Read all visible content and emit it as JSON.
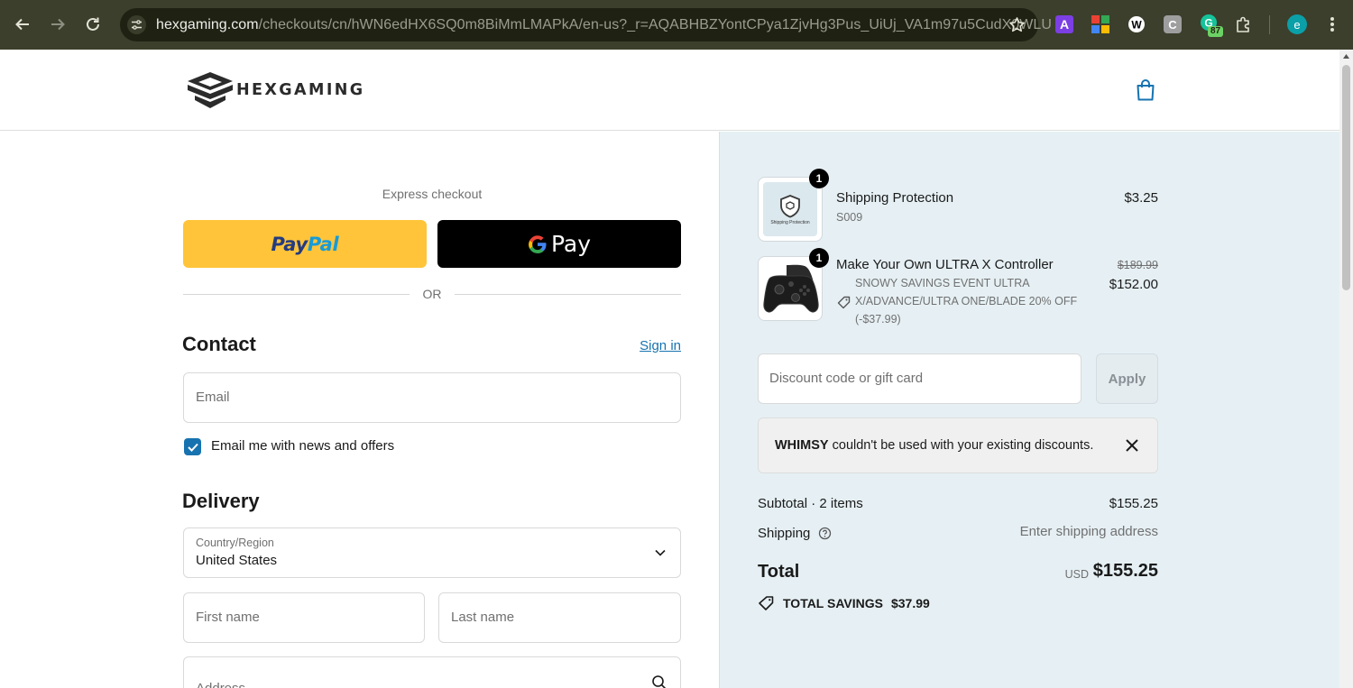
{
  "browser": {
    "url_host": "hexgaming.com",
    "url_path": "/checkouts/cn/hWN6edHX6SQ0m8BiMmLMAPkA/en-us?_r=AQABHBZYontCPya1ZjvHg3Pus_UiUj_VA1m97u5CudX0WLU",
    "extension_badge": "87",
    "profile_initial": "e"
  },
  "header": {
    "logo_text": "HEXGAMING"
  },
  "express": {
    "title": "Express checkout",
    "paypal_part1": "Pay",
    "paypal_part2": "Pal",
    "gpay_label": "Pay",
    "or_label": "OR"
  },
  "contact": {
    "title": "Contact",
    "signin_label": "Sign in",
    "email_placeholder": "Email",
    "newsletter_label": "Email me with news and offers",
    "newsletter_checked": true
  },
  "delivery": {
    "title": "Delivery",
    "country_label": "Country/Region",
    "country_value": "United States",
    "first_name_placeholder": "First name",
    "last_name_placeholder": "Last name",
    "address_placeholder": "Address"
  },
  "order": {
    "items": [
      {
        "name": "Shipping Protection",
        "sub": "S009",
        "price": "$3.25",
        "quantity": "1",
        "thumb_text": "Shipping Protection"
      },
      {
        "name": "Make Your Own ULTRA X Controller",
        "discount_line1": "SNOWY SAVINGS EVENT ULTRA",
        "discount_line2": "X/ADVANCE/ULTRA ONE/BLADE 20% OFF",
        "discount_line3": "(-$37.99)",
        "old_price": "$189.99",
        "price": "$152.00",
        "quantity": "1"
      }
    ],
    "discount_placeholder": "Discount code or gift card",
    "apply_label": "Apply",
    "notice_code": "WHIMSY",
    "notice_text": " couldn't be used with your existing discounts.",
    "subtotal_label": "Subtotal · 2 items",
    "subtotal_value": "$155.25",
    "shipping_label": "Shipping",
    "shipping_value": "Enter shipping address",
    "total_label": "Total",
    "total_currency": "USD",
    "total_value": "$155.25",
    "savings_label": "TOTAL SAVINGS",
    "savings_value": "$37.99"
  },
  "colors": {
    "accent": "#1773b0",
    "paypal_yellow": "#ffc439",
    "sidebar_bg": "#e6f0f4"
  }
}
